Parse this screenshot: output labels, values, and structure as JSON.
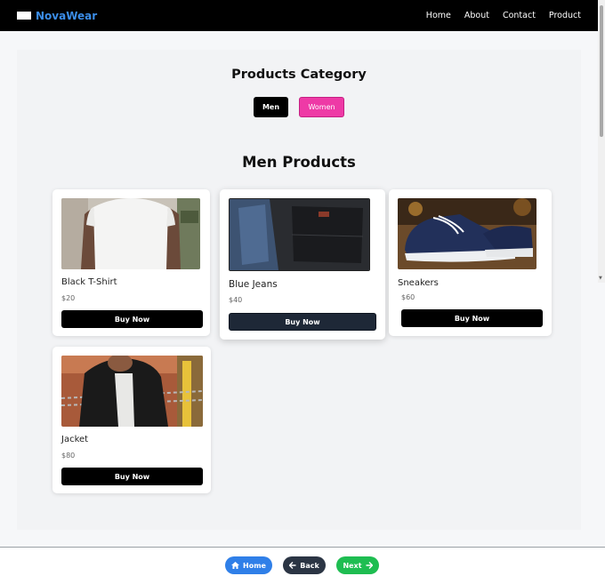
{
  "navbar": {
    "brand": "NovaWear",
    "links": [
      "Home",
      "About",
      "Contact",
      "Product"
    ]
  },
  "category": {
    "title": "Products Category",
    "buttons": [
      "Men",
      "Women"
    ]
  },
  "section_title": "Men Products",
  "products": [
    {
      "name": "Black T-Shirt",
      "price": "$20",
      "button": "Buy Now"
    },
    {
      "name": "Blue Jeans",
      "price": "$40",
      "button": "Buy Now"
    },
    {
      "name": "Sneakers",
      "price": "$60",
      "button": "Buy Now"
    },
    {
      "name": "Jacket",
      "price": "$80",
      "button": "Buy Now"
    }
  ],
  "bottom_nav": {
    "home": "Home",
    "back": "Back",
    "next": "Next"
  },
  "colors": {
    "navbar": "#000000",
    "brand": "#3b8de8",
    "women_button": "#ee3aa6",
    "home_pill": "#2f7fe8",
    "back_pill": "#2b3544",
    "next_pill": "#1ebd51"
  }
}
